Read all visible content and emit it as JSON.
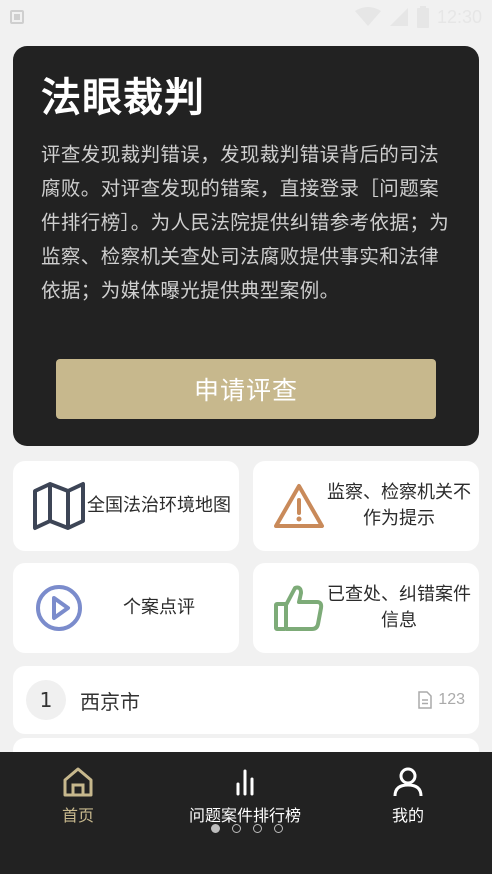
{
  "status_bar": {
    "time": "12:30",
    "icons": [
      "notification-icon",
      "wifi-icon",
      "signal-icon",
      "battery-icon"
    ]
  },
  "hero": {
    "title": "法眼裁判",
    "description": "评查发现裁判错误，发现裁判错误背后的司法腐败。对评查发现的错案，直接登录［问题案件排行榜］。为人民法院提供纠错参考依据；为监察、检察机关查处司法腐败提供事实和法律依据；为媒体曝光提供典型案例。",
    "apply_button": "申请评查"
  },
  "features": [
    {
      "label": "全国法治环境地图",
      "icon": "map-icon",
      "color": "#3d4556"
    },
    {
      "label": "监察、检察机关不作为提示",
      "icon": "warning-icon",
      "color": "#c98a5a"
    },
    {
      "label": "个案点评",
      "icon": "play-icon",
      "color": "#7b8ccc"
    },
    {
      "label": "已查处、纠错案件信息",
      "icon": "thumbs-up-icon",
      "color": "#7dab78"
    }
  ],
  "list": [
    {
      "rank": "1",
      "city": "西京市",
      "count": "123"
    }
  ],
  "nav": {
    "items": [
      {
        "label": "首页",
        "icon": "home-icon",
        "active": true
      },
      {
        "label": "问题案件排行榜",
        "icon": "bar-chart-icon",
        "active": false
      },
      {
        "label": "我的",
        "icon": "user-icon",
        "active": false
      }
    ],
    "page_dots": 4,
    "active_dot": 1
  },
  "colors": {
    "accent": "#c7b88d",
    "dark": "#222222",
    "background": "#f1f1f1"
  }
}
